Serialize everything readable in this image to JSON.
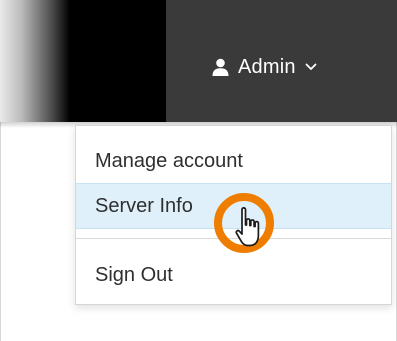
{
  "header": {
    "user_label": "Admin",
    "user_icon": "user-icon",
    "chevron_icon": "chevron-down-icon"
  },
  "dropdown": {
    "items": [
      {
        "label": "Manage account"
      },
      {
        "label": "Server Info",
        "highlighted": true
      },
      {
        "label": "Sign Out"
      }
    ]
  },
  "overlay": {
    "cursor_icon": "hand-pointer-icon",
    "highlight_ring_color": "#ee7d00"
  },
  "colors": {
    "topbar": "#3a3a3a",
    "highlight_row": "#dff0fb",
    "text": "#2f2f2f"
  }
}
